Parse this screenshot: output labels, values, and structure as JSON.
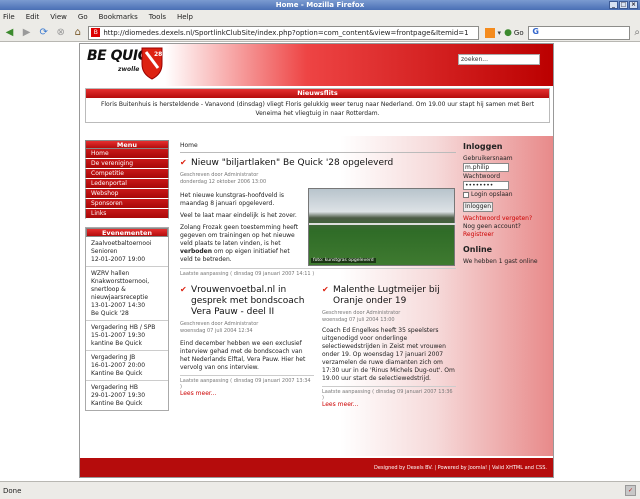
{
  "window": {
    "title": "Home - Mozilla Firefox"
  },
  "menubar": [
    "File",
    "Edit",
    "View",
    "Go",
    "Bookmarks",
    "Tools",
    "Help"
  ],
  "toolbar": {
    "url": "http://diomedes.dexels.nl/SportlinkClubSite/index.php?option=com_content&view=frontpage&Itemid=1",
    "go_label": "Go"
  },
  "status": {
    "text": "Done"
  },
  "site": {
    "logo": {
      "name": "BE QUICK",
      "sub": "zwolle",
      "year": "28"
    },
    "search_value": "zoeken...",
    "news": {
      "header": "Nieuwsflits",
      "text": "Floris Buitenhuis is hersteldende - Vanavond (dinsdag) vliegt Floris gelukkig weer terug naar Nederland. Om 19.00 uur stapt hij samen met Bert Veneima het vliegtuig in naar Rotterdam."
    },
    "menu": {
      "header": "Menu",
      "items": [
        "Home",
        "De vereniging",
        "Competitie",
        "Ledenportal",
        "Webshop",
        "Sponsoren",
        "Links"
      ]
    },
    "events": {
      "header": "Evenementen",
      "items": [
        "Zaalvoetbaltoernooi\nSenioren\n12-01-2007 19:00",
        "WZRV hallen\nKnakworsttoernooi,\nsnertloop &\nnieuwjaarsreceptie\n13-01-2007 14:30\nBe Quick '28",
        "Vergadering HB / SPB\n15-01-2007 19:30\nkantine Be Quick",
        "Vergadering JB\n16-01-2007 20:00\nKantine Be Quick",
        "Vergadering HB\n29-01-2007 19:30\nKantine Be Quick"
      ]
    },
    "breadcrumb": "Home",
    "article1": {
      "title": "Nieuw \"biljartlaken\" Be Quick '28 opgeleverd",
      "author": "Geschreven door Administrator",
      "date": "donderdag 12 oktober 2006 13:00",
      "p1": "Het nieuwe kunstgras-hoofdveld is maandag 8 januari opgeleverd.",
      "p2": "Veel te laat maar eindelijk is het zover.",
      "p3_a": "Zolang Frozak geen toestemming heeft gegeven om trainingen op het nieuwe veld plaats te laten vinden, is het ",
      "p3_bold": "verboden",
      "p3_b": " om op eigen initiatief het veld te betreden.",
      "photo_caption": "foto: kunstgras opgeleverd",
      "lastmod": "Laatste aanpassing ( dinsdag 09 januari 2007 14:11 )"
    },
    "article2": {
      "title": "Vrouwenvoetbal.nl in gesprek met bondscoach Vera Pauw - deel II",
      "author": "Geschreven door Administrator",
      "date": "woensdag 07 juli 2004 12:34",
      "text": "Eind december hebben we een exclusief interview gehad met de bondscoach van het Nederlands Elftal, Vera Pauw. Hier het vervolg van ons interview.",
      "lastmod": "Laatste aanpassing ( dinsdag 09 januari 2007 13:34 )",
      "readmore": "Lees meer..."
    },
    "article3": {
      "title": "Malenthe Lugtmeijer bij Oranje onder 19",
      "author": "Geschreven door Administrator",
      "date": "woensdag 07 juli 2004 13:00",
      "text": "Coach Ed Engelkes heeft 35 speelsters uitgenodigd voor onderlinge selectiewedstrijden in Zeist met vrouwen onder 19. Op woensdag 17 januari 2007 verzamelen de ruwe diamanten zich om 17:30 uur in de 'Rinus Michels Dug-out'. Om 19.00 uur start de selectiewedstrijd.",
      "lastmod": "Laatste aanpassing ( dinsdag 09 januari 2007 13:36 )",
      "readmore": "Lees meer..."
    },
    "login": {
      "header": "Inloggen",
      "username_label": "Gebruikersnaam",
      "username_value": "m.philip",
      "password_label": "Wachtwoord",
      "password_value": "••••••••",
      "remember_label": "Login opslaan",
      "button": "Inloggen",
      "forgot": "Wachtwoord vergeten?",
      "no_account": "Nog geen account?",
      "register": "Registreer"
    },
    "online": {
      "header": "Online",
      "text": "We hebben 1 gast online"
    },
    "footer": "Designed by Dexels BV.  |  Powered by Joomla!  |  Valid XHTML and CSS."
  }
}
